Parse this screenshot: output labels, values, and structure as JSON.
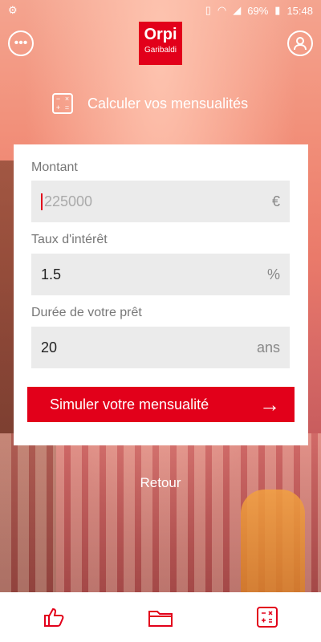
{
  "status_bar": {
    "time": "15:48",
    "battery": "69%"
  },
  "header": {
    "logo_brand": "Orpi",
    "logo_sub": "Garibaldi",
    "menu_icon": "ellipsis-icon",
    "profile_icon": "user-icon"
  },
  "title": {
    "text": "Calculer vos mensualités",
    "icon": "calculator-icon"
  },
  "form": {
    "amount": {
      "label": "Montant",
      "placeholder": "225000",
      "unit": "€"
    },
    "rate": {
      "label": "Taux d'intérêt",
      "value": "1.5",
      "unit": "%"
    },
    "duration": {
      "label": "Durée de votre prêt",
      "value": "20",
      "unit": "ans"
    },
    "submit_label": "Simuler votre mensualité"
  },
  "back_link": "Retour",
  "bottom_nav": [
    "thumbs-up-icon",
    "folder-icon",
    "calculator-icon"
  ],
  "colors": {
    "accent": "#e2001a"
  }
}
